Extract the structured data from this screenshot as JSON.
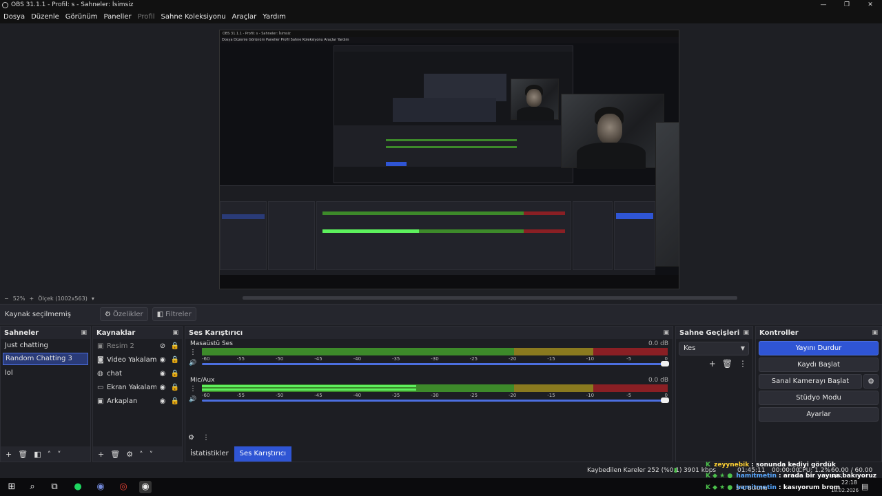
{
  "window": {
    "title": "OBS 31.1.1 - Profil: s - Sahneler: İsimsiz",
    "controls": [
      "—",
      "❐",
      "✕"
    ]
  },
  "menu": [
    "Dosya",
    "Düzenle",
    "Görünüm",
    "Paneller",
    "Profil",
    "Sahne Koleksiyonu",
    "Araçlar",
    "Yardım"
  ],
  "preview": {
    "inner_title": "OBS 31.1.1 - Profil: s - Sahneler: İsimsiz",
    "inner_menu": "Dosya  Düzenle  Görünüm  Paneller  Profil  Sahne Koleksiyonu  Araçlar  Yardım",
    "zoom": "52%",
    "scale": "Ölçek (1002x563)"
  },
  "context_bar": {
    "label": "Kaynak seçilmemiş",
    "properties": "Özelikler",
    "filters": "Filtreler"
  },
  "scenes": {
    "title": "Sahneler",
    "items": [
      {
        "label": "Just chatting",
        "active": false
      },
      {
        "label": "Random Chatting 3",
        "active": true
      },
      {
        "label": "lol",
        "active": false
      }
    ]
  },
  "sources": {
    "title": "Kaynaklar",
    "items": [
      {
        "label": "Resim 2",
        "icon": "image-icon",
        "visible": false
      },
      {
        "label": "Video Yakalama A",
        "icon": "camera-icon",
        "visible": true
      },
      {
        "label": "chat",
        "icon": "globe-icon",
        "visible": true
      },
      {
        "label": "Ekran Yakalama",
        "icon": "monitor-icon",
        "visible": true
      },
      {
        "label": "Arkaplan",
        "icon": "image-icon",
        "visible": true
      }
    ]
  },
  "mixer": {
    "title": "Ses Karıştırıcı",
    "ticks": [
      "-60",
      "-55",
      "-50",
      "-45",
      "-40",
      "-35",
      "-30",
      "-25",
      "-20",
      "-15",
      "-10",
      "-5",
      "0"
    ],
    "channels": [
      {
        "name": "Masaüstü Ses",
        "db": "0.0 dB",
        "level": 0.0,
        "volume": 1.0
      },
      {
        "name": "Mic/Aux",
        "db": "0.0 dB",
        "level": 0.46,
        "volume": 1.0
      }
    ],
    "tabs": [
      "İstatistikler",
      "Ses Karıştırıcı"
    ],
    "active_tab": 1
  },
  "transitions": {
    "title": "Sahne Geçişleri",
    "selected": "Kes"
  },
  "controls": {
    "title": "Kontroller",
    "stop_stream": "Yayını Durdur",
    "start_recording": "Kaydı Başlat",
    "virtual_cam": "Sanal Kamerayı Başlat",
    "studio_mode": "Stüdyo Modu",
    "settings": "Ayarlar"
  },
  "status": {
    "dropped": "Kaybedilen Kareler 252 (%0.1)",
    "bitrate": "3901 kbps",
    "time": "01:45:11",
    "rec_time": "00:00:00",
    "cpu": "CPU: 1.2%",
    "fps": "60.00 / 60.00 FPS"
  },
  "chat": [
    {
      "user": "zeyynebik",
      "message": ": sonunda kediyi gördük"
    },
    {
      "user": "hamitmetin",
      "message": ": arada bir yayına bakıyoruz"
    },
    {
      "user": "hamitmetin",
      "message": ": kasıyorum brom"
    }
  ],
  "clock": {
    "time": "22:18",
    "date": "18.02.2026"
  },
  "weather": "5°C  Bulutlu",
  "colors": {
    "accent": "#2f55d4",
    "meter_green": "#3d8a2a",
    "meter_yellow": "#8a7a1f",
    "meter_red": "#8a1f24",
    "level_green": "#5df05d"
  }
}
